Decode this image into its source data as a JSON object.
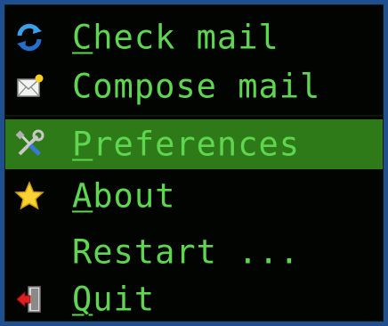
{
  "menu": {
    "items": [
      {
        "id": "check-mail",
        "mnemonic": "C",
        "rest": "heck mail",
        "icon": "refresh-icon",
        "highlighted": false
      },
      {
        "id": "compose-mail",
        "mnemonic": "",
        "rest": "Compose mail",
        "icon": "compose-mail-icon",
        "highlighted": false
      },
      {
        "id": "preferences",
        "mnemonic": "P",
        "rest": "references",
        "icon": "tools-icon",
        "highlighted": true
      },
      {
        "id": "about",
        "mnemonic": "A",
        "rest": "bout",
        "icon": "star-icon",
        "highlighted": false
      },
      {
        "id": "restart",
        "mnemonic": "",
        "rest": "Restart ...",
        "icon": "",
        "highlighted": false
      },
      {
        "id": "quit",
        "mnemonic": "Q",
        "rest": "uit",
        "icon": "exit-icon",
        "highlighted": false
      }
    ]
  },
  "colors": {
    "background": "#020402",
    "text": "#5fd64f",
    "highlight": "#2e7a18",
    "frame": "#1f4f8f"
  }
}
